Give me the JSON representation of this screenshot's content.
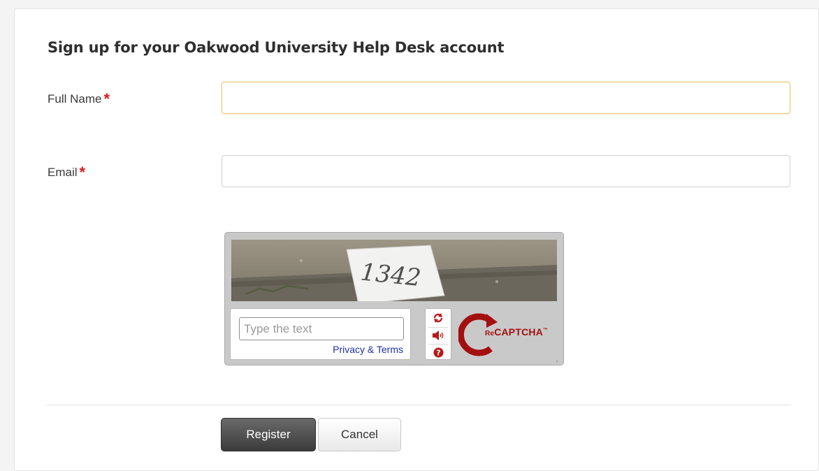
{
  "form": {
    "title": "Sign up for your Oakwood University Help Desk account",
    "full_name_label": "Full Name",
    "email_label": "Email",
    "required_marker": "*",
    "full_name_value": "",
    "email_value": ""
  },
  "captcha": {
    "challenge_text": "1342",
    "input_placeholder": "Type the text",
    "privacy_link": "Privacy & Terms",
    "brand_prefix": "Re",
    "brand_name": "CAPTCHA",
    "trademark": "™",
    "controls": [
      "refresh-icon",
      "audio-icon",
      "help-icon"
    ]
  },
  "actions": {
    "register_label": "Register",
    "cancel_label": "Cancel"
  },
  "colors": {
    "required": "#d81c1c",
    "focus_border": "#e8c872",
    "recaptcha_red": "#a40f0f",
    "link_blue": "#1c2fa8"
  }
}
